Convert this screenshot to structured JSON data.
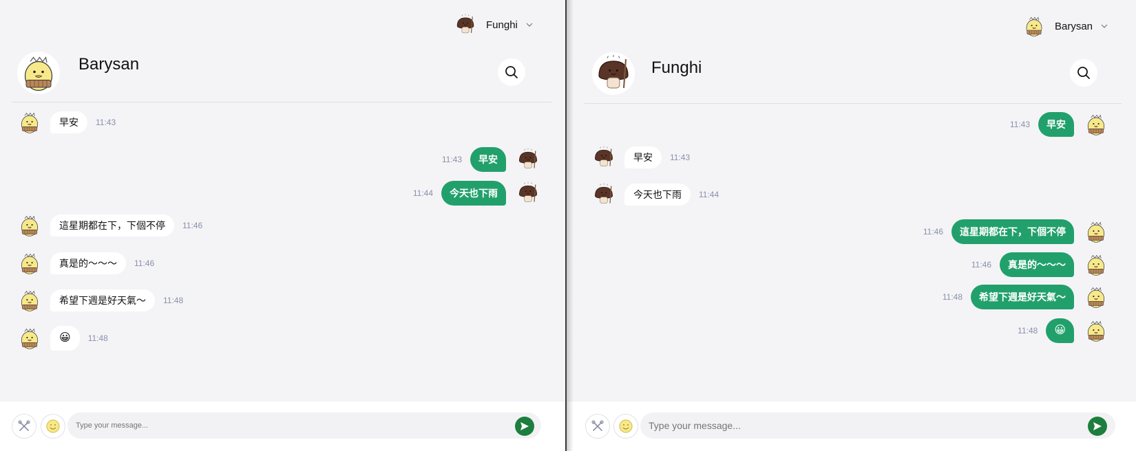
{
  "left": {
    "current_user": {
      "name": "Funghi",
      "avatar": "mushroom-avatar"
    },
    "contact": {
      "name": "Barysan",
      "avatar": "chick-avatar"
    },
    "messages": [
      {
        "dir": "in",
        "text": "早安",
        "time": "11:43"
      },
      {
        "dir": "out",
        "text": "早安",
        "time": "11:43"
      },
      {
        "dir": "out",
        "text": "今天也下雨",
        "time": "11:44"
      },
      {
        "dir": "in",
        "text": "這星期都在下，下個不停",
        "time": "11:46"
      },
      {
        "dir": "in",
        "text": "真是的～～～",
        "time": "11:46"
      },
      {
        "dir": "in",
        "text": "希望下週是好天氣～",
        "time": "11:48"
      },
      {
        "dir": "in",
        "text": "😀",
        "time": "11:48"
      }
    ],
    "composer": {
      "placeholder": "Type your message..."
    }
  },
  "right": {
    "current_user": {
      "name": "Barysan",
      "avatar": "chick-avatar"
    },
    "contact": {
      "name": "Funghi",
      "avatar": "mushroom-avatar"
    },
    "messages": [
      {
        "dir": "out",
        "text": "早安",
        "time": "11:43"
      },
      {
        "dir": "in",
        "text": "早安",
        "time": "11:43"
      },
      {
        "dir": "in",
        "text": "今天也下雨",
        "time": "11:44"
      },
      {
        "dir": "out",
        "text": "這星期都在下，下個不停",
        "time": "11:46"
      },
      {
        "dir": "out",
        "text": "真是的～～～",
        "time": "11:46"
      },
      {
        "dir": "out",
        "text": "希望下週是好天氣～",
        "time": "11:48"
      },
      {
        "dir": "out",
        "text": "😀",
        "time": "11:48"
      }
    ],
    "composer": {
      "placeholder": "Type your message..."
    }
  },
  "icons": {
    "chevron": "chevron-down-icon",
    "search": "search-icon",
    "tools": "tools-icon",
    "emoji": "emoji-icon",
    "send": "send-icon"
  },
  "colors": {
    "outgoing_bubble": "#22a06b",
    "incoming_bubble": "#ffffff",
    "send_button": "#1e7e3e",
    "background": "#f4f4f7",
    "timestamp": "#8a8fa8"
  }
}
